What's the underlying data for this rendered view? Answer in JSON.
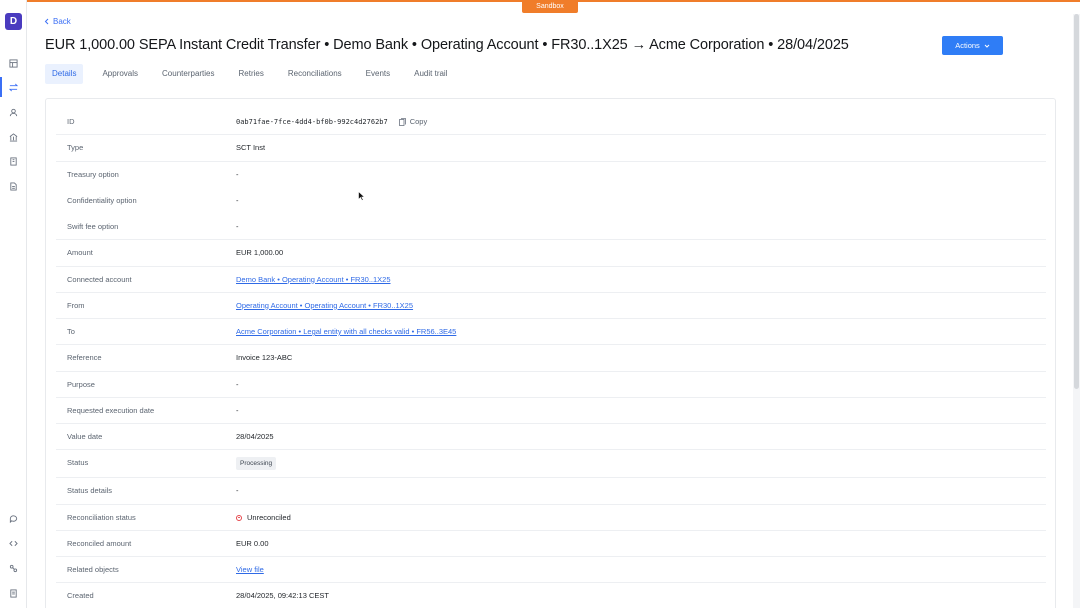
{
  "environment": {
    "badge": "Sandbox",
    "accent": "#f07d2a"
  },
  "sidebar": {
    "logo": "D",
    "items": [
      {
        "icon": "dashboard-icon"
      },
      {
        "icon": "transfer-icon",
        "active": true
      },
      {
        "icon": "user-icon"
      },
      {
        "icon": "bank-icon"
      },
      {
        "icon": "building-icon"
      },
      {
        "icon": "document-icon"
      }
    ],
    "bottom_items": [
      {
        "icon": "chat-icon"
      },
      {
        "icon": "code-icon"
      },
      {
        "icon": "settings-icon"
      },
      {
        "icon": "book-icon"
      }
    ]
  },
  "header": {
    "back_label": "Back",
    "title": "EUR 1,000.00 SEPA Instant Credit Transfer • Demo Bank • Operating Account • FR30..1X25 → Acme Corporation • 28/04/2025",
    "actions_label": "Actions"
  },
  "tabs": [
    {
      "label": "Details",
      "active": true
    },
    {
      "label": "Approvals"
    },
    {
      "label": "Counterparties"
    },
    {
      "label": "Retries"
    },
    {
      "label": "Reconciliations"
    },
    {
      "label": "Events"
    },
    {
      "label": "Audit trail"
    }
  ],
  "details": {
    "id": {
      "label": "ID",
      "value": "0ab71fae-7fce-4dd4-bf0b-992c4d2762b7",
      "copy_label": "Copy"
    },
    "type": {
      "label": "Type",
      "value": "SCT Inst"
    },
    "treasury_option": {
      "label": "Treasury option",
      "value": "-"
    },
    "confidentiality_option": {
      "label": "Confidentiality option",
      "value": "-"
    },
    "swift_fee_option": {
      "label": "Swift fee option",
      "value": "-"
    },
    "amount": {
      "label": "Amount",
      "value": "EUR 1,000.00"
    },
    "connected_account": {
      "label": "Connected account",
      "value": "Demo Bank • Operating Account • FR30..1X25"
    },
    "from": {
      "label": "From",
      "value": "Operating Account • Operating Account • FR30..1X25"
    },
    "to": {
      "label": "To",
      "value": "Acme Corporation • Legal entity with all checks valid • FR56..3E45"
    },
    "reference": {
      "label": "Reference",
      "value": "Invoice 123-ABC"
    },
    "purpose": {
      "label": "Purpose",
      "value": "-"
    },
    "requested_execution_date": {
      "label": "Requested execution date",
      "value": "-"
    },
    "value_date": {
      "label": "Value date",
      "value": "28/04/2025"
    },
    "status": {
      "label": "Status",
      "value": "Processing"
    },
    "status_details": {
      "label": "Status details",
      "value": "-"
    },
    "reconciliation_status": {
      "label": "Reconciliation status",
      "value": "Unreconciled",
      "color": "#e5484d"
    },
    "reconciled_amount": {
      "label": "Reconciled amount",
      "value": "EUR 0.00"
    },
    "related_objects": {
      "label": "Related objects",
      "value": "View file"
    },
    "created": {
      "label": "Created",
      "value": "28/04/2025, 09:42:13 CEST"
    }
  }
}
